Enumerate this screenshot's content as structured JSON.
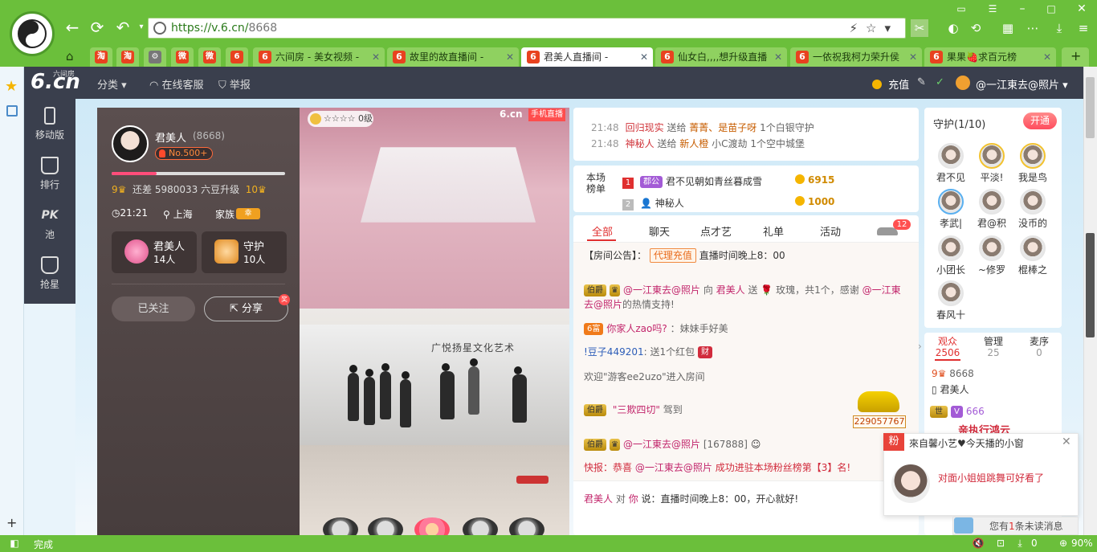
{
  "browser": {
    "url_host": "https://v.6.cn/",
    "url_path": "8668",
    "tabs": [
      {
        "label": "六间房 - 美女视频 -",
        "icon": "6"
      },
      {
        "label": "故里的故直播间 -",
        "icon": "6"
      },
      {
        "label": "君美人直播间 - ",
        "icon": "6",
        "active": true
      },
      {
        "label": "仙女白,,,,想升级直播",
        "icon": "6"
      },
      {
        "label": "一依祝我柯力荣升侯",
        "icon": "6"
      },
      {
        "label": "果果🍓求百元榜",
        "icon": "6"
      }
    ],
    "small_tabs": [
      "淘",
      "淘",
      "⚙",
      "微",
      "微",
      "6"
    ],
    "status": "完成",
    "zoom": "90%",
    "count": "0",
    "new_tab": "+"
  },
  "header": {
    "logo_main": "6.cn",
    "logo_small": "六间房",
    "category": "分类",
    "service": "在线客服",
    "report": "举报",
    "recharge": "充值",
    "user": "@一江東去@照片"
  },
  "left_nav": [
    {
      "label": "移动版",
      "icon": "mobile-icon"
    },
    {
      "label": "排行",
      "icon": "crown-icon"
    },
    {
      "label": "池",
      "icon": "pk-icon"
    },
    {
      "label": "抢星",
      "icon": "bag-icon"
    }
  ],
  "left_nav_pk": "PK",
  "streamer": {
    "name": "君美人",
    "id": "(8668)",
    "rank_badge": "No.500+",
    "level_from": "9",
    "level_to": "10",
    "level_text": "还差 5980033 六豆升级",
    "level_progress": 0.26,
    "time": "21:21",
    "location": "上海",
    "family_label": "家族",
    "family_badge": "幸",
    "stat1_title": "君美人",
    "stat1_value": "14人",
    "stat2_title": "守护",
    "stat2_value": "10人",
    "followed": "已关注",
    "share": "分享",
    "share_badge": "奖"
  },
  "video": {
    "level_badge": "0级",
    "watermark": "6.cn",
    "watermark_tag": "手机直播",
    "wall_text": "广悦扬星文化艺术"
  },
  "gift_news": [
    {
      "time": "21:48",
      "from": "回归",
      "mid": "现实",
      "action": "送给",
      "to": "菁菁、是苗子呀",
      "item": "1个白银守护"
    },
    {
      "time": "21:48",
      "from": "神秘人",
      "mid": "",
      "action": "送给",
      "to": "新人橙",
      "item": "小C渡劫 1个空中城堡"
    }
  ],
  "rank": {
    "label": "本场榜单",
    "rows": [
      {
        "num": "1",
        "badge": "郡公",
        "name": "君不见朝如青丝暮成雪",
        "value": "6915"
      },
      {
        "num": "2",
        "badge": "",
        "name": "神秘人",
        "value": "1000"
      }
    ]
  },
  "chat": {
    "tabs": [
      "全部",
      "聊天",
      "点才艺",
      "礼单",
      "活动"
    ],
    "badge_count": "12",
    "announcement_prefix": "【房间公告】：",
    "announcement_btn": "代理充值",
    "announcement_text": "直播时间晚上8：00",
    "msg1_badge": "伯爵",
    "msg1_user": "@一江東去@照片",
    "msg1_to_prefix": "向",
    "msg1_to": "君美人",
    "msg1_action": "送",
    "msg1_gift": "玫瑰，共1个，感谢",
    "msg1_thanks": "@一江東去@照片",
    "msg1_suffix": "的热情支持!",
    "msg2_badge": "6富",
    "msg2_user": "你家人zao吗?",
    "msg2_text": "：妹妹手好美",
    "msg3_user": "!豆子449201",
    "msg3_text": ": 送1个红包",
    "msg4_text": "欢迎\"游客ee2uzo\"进入房间",
    "msg5_badge": "伯爵",
    "msg5_text": "\"三欺四切\"",
    "msg5_suffix": "驾到",
    "car_number": "229057767",
    "msg6_badge": "伯爵",
    "msg6_user": "@一江東去@照片",
    "msg6_id": "[167888]",
    "msg7_prefix": "快报：恭喜",
    "msg7_user": "@一江東去@照片",
    "msg7_text": "成功进驻本场粉丝榜第【3】名!",
    "bottom_from": "君美人",
    "bottom_mid": "对",
    "bottom_to": "你",
    "bottom_text": "说：直播时间晚上8：00，开心就好!"
  },
  "guard": {
    "title": "守护",
    "count": "(1/10)",
    "open": "开通",
    "members": [
      "君不见",
      "平淡!",
      "我是鸟",
      "孝武|",
      "君@积",
      "没币的",
      "小团长",
      "~修罗",
      "棍棒之",
      "春风十"
    ]
  },
  "audience": {
    "tabs": [
      {
        "label": "观众",
        "value": "2506"
      },
      {
        "label": "管理",
        "value": "25"
      },
      {
        "label": "麦序",
        "value": "0"
      }
    ],
    "row1_level": "9",
    "row1_id": "8668",
    "row1_name": "君美人",
    "row2_vip": "V",
    "row2_num": "666",
    "row3": "亲执行鸿云"
  },
  "notification": {
    "tag": "粉",
    "title": "來自馨小艺♥今天播的小窗",
    "message": "对面小姐姐跳舞可好看了",
    "unread_prefix": "您有",
    "unread_count": "1",
    "unread_suffix": "条未读消息"
  }
}
